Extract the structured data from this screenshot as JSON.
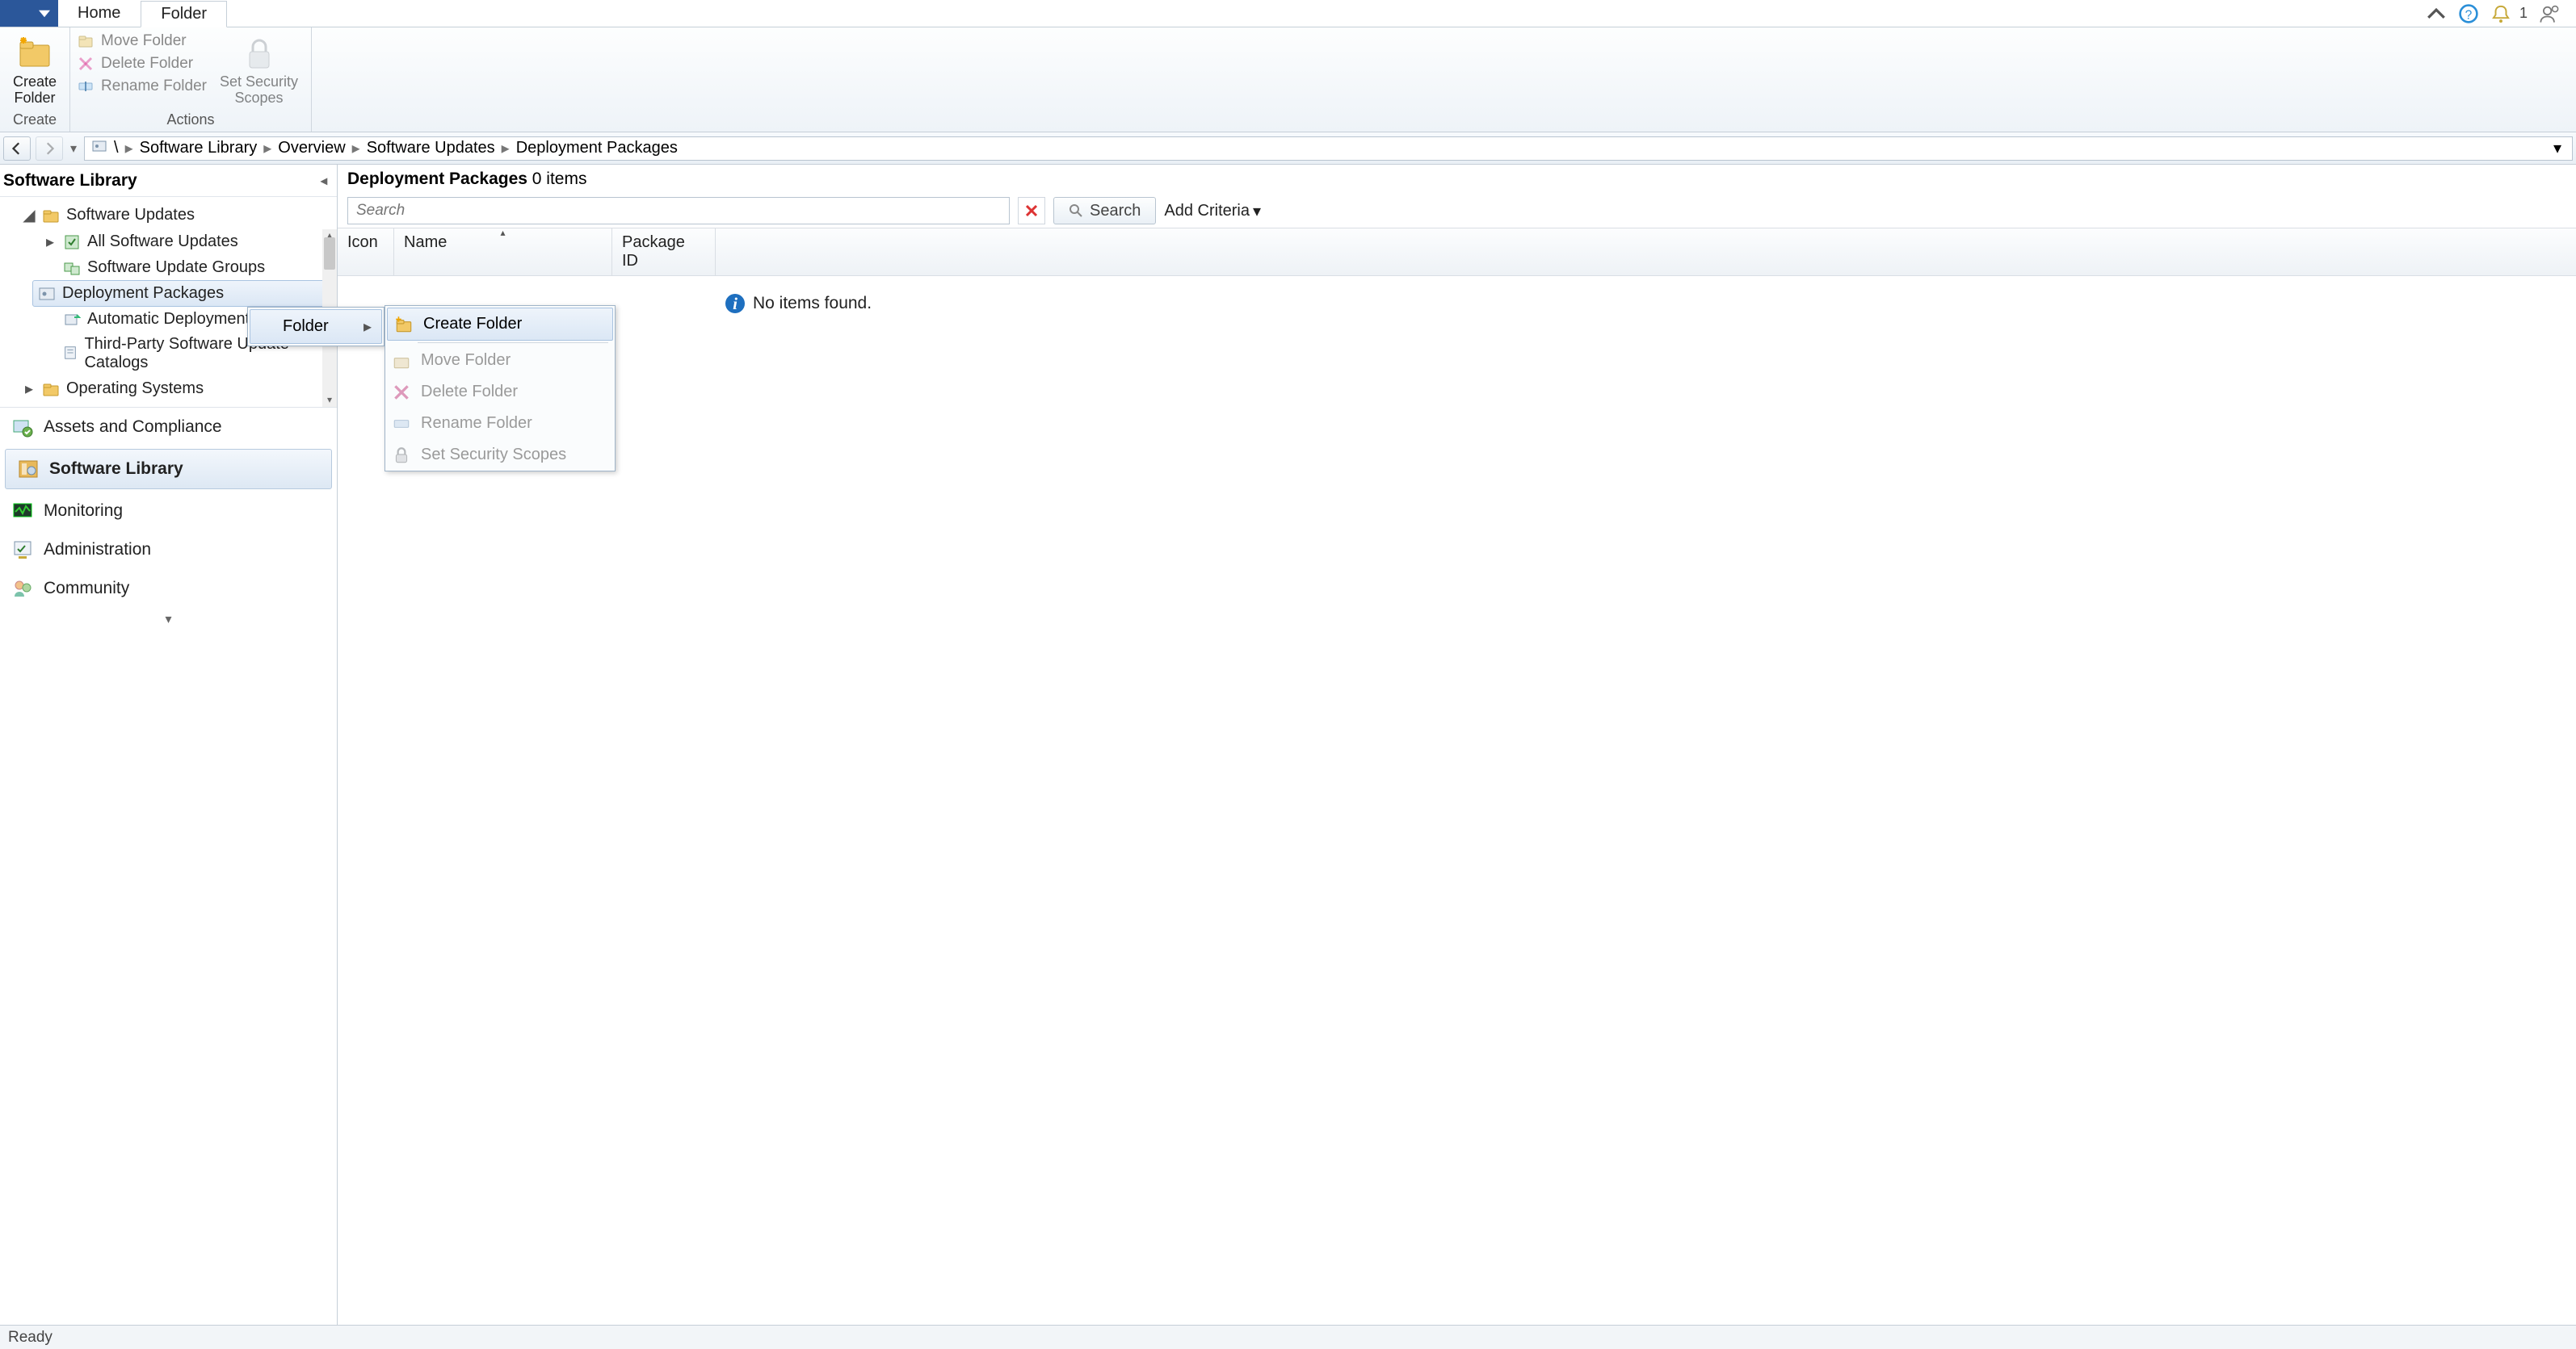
{
  "tabs": {
    "home": "Home",
    "folder": "Folder"
  },
  "title_right": {
    "notif_count": "1"
  },
  "ribbon": {
    "create_group_label": "Create",
    "create_folder_btn": "Create\nFolder",
    "actions_group_label": "Actions",
    "move_folder": "Move Folder",
    "delete_folder": "Delete Folder",
    "rename_folder": "Rename Folder",
    "set_security_scopes": "Set Security\nScopes"
  },
  "breadcrumb": {
    "root": "\\",
    "items": [
      "Software Library",
      "Overview",
      "Software Updates",
      "Deployment Packages"
    ]
  },
  "left": {
    "header": "Software Library",
    "tree": {
      "software_updates": "Software Updates",
      "all_software_updates": "All Software Updates",
      "software_update_groups": "Software Update Groups",
      "deployment_packages": "Deployment Packages",
      "automatic_deployment_rules": "Automatic Deployment Rules",
      "third_party_catalogs": "Third-Party Software Update Catalogs",
      "operating_systems": "Operating Systems"
    },
    "sections": {
      "assets": "Assets and Compliance",
      "software_library": "Software Library",
      "monitoring": "Monitoring",
      "administration": "Administration",
      "community": "Community"
    }
  },
  "content": {
    "heading_name": "Deployment Packages",
    "heading_count": "0 items",
    "search_placeholder": "Search",
    "search_button": "Search",
    "add_criteria": "Add Criteria",
    "columns": {
      "icon": "Icon",
      "name": "Name",
      "package_id": "Package ID"
    },
    "no_items": "No items found."
  },
  "context_menu": {
    "parent": "Folder",
    "items": {
      "create_folder": "Create Folder",
      "move_folder": "Move Folder",
      "delete_folder": "Delete Folder",
      "rename_folder": "Rename Folder",
      "set_security_scopes": "Set Security Scopes"
    }
  },
  "status": "Ready"
}
